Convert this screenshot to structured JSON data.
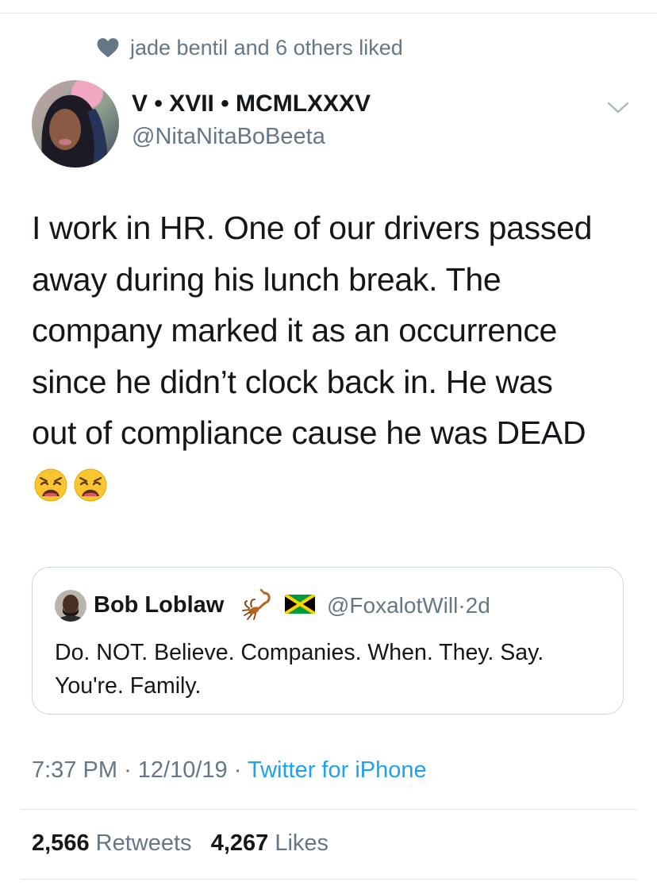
{
  "social_context": {
    "icon": "heart-icon",
    "text": "jade bentil and 6 others liked"
  },
  "author": {
    "display_name": "V • XVII • MCMLXXXV",
    "handle": "@NitaNitaBoBeeta"
  },
  "tweet": {
    "lines": [
      "I work in HR. One of our drivers passed",
      "away during his lunch break. The",
      "company marked it as an occurrence",
      "since he didn’t clock back in. He was",
      "out of compliance cause he was DEAD"
    ],
    "emojis": [
      "weary-face-emoji",
      "weary-face-emoji"
    ]
  },
  "quoted_tweet": {
    "display_name": "Bob Loblaw",
    "name_emojis": [
      "scorpion-emoji",
      "jamaica-flag-emoji"
    ],
    "handle": "@FoxalotWill",
    "separator": "·",
    "age": "2d",
    "lines": [
      "Do. NOT. Believe. Companies. When. They. Say.",
      "You're. Family."
    ]
  },
  "meta": {
    "time": "7:37 PM",
    "date": "12/10/19",
    "separator": "·",
    "source": "Twitter for iPhone"
  },
  "stats": {
    "retweets_count": "2,566",
    "retweets_label": "Retweets",
    "likes_count": "4,267",
    "likes_label": "Likes"
  },
  "colors": {
    "text_primary": "#14171a",
    "text_secondary": "#657786",
    "link": "#1da1f2",
    "divider": "#e1e8ed",
    "card_border": "#ccd6dd"
  }
}
